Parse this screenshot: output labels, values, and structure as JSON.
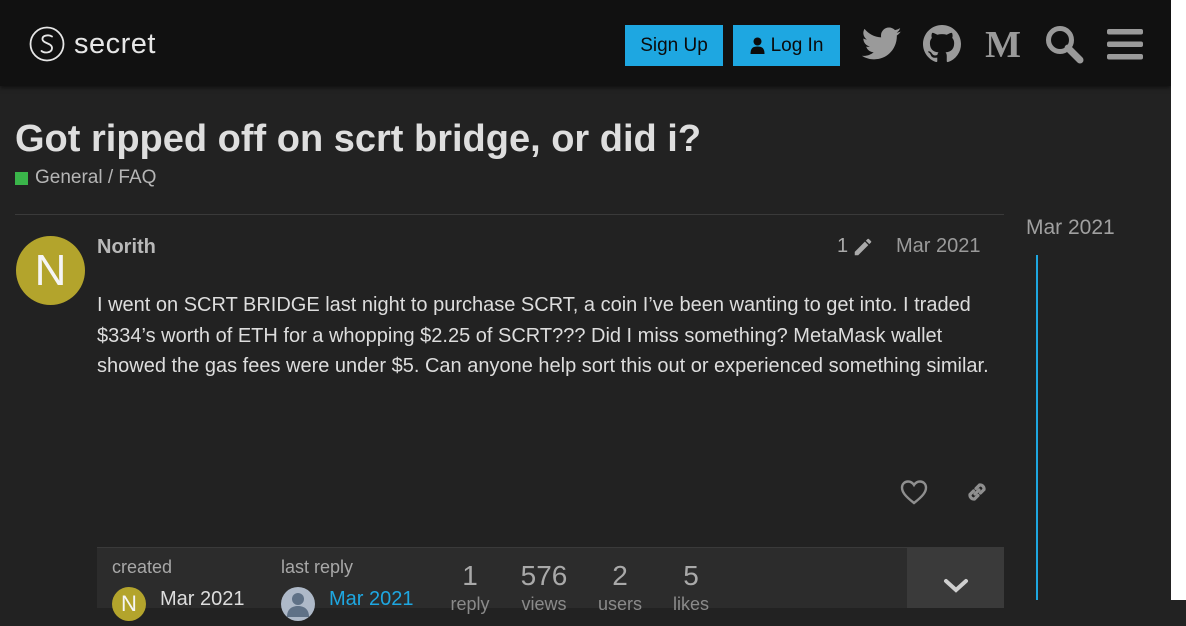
{
  "brand": {
    "name": "secret"
  },
  "header": {
    "signup_label": "Sign Up",
    "login_label": "Log In",
    "icons": [
      "twitter-icon",
      "github-icon",
      "medium-icon",
      "search-icon",
      "hamburger-menu-icon"
    ]
  },
  "topic": {
    "title": "Got ripped off on scrt bridge, or did i?",
    "category": "General / FAQ",
    "category_color": "#3ab54a"
  },
  "post": {
    "avatar_letter": "N",
    "avatar_color": "#b3a42c",
    "username": "Norith",
    "edit_count": "1",
    "date": "Mar 2021",
    "body": "I went on SCRT BRIDGE last night to purchase SCRT, a coin I’ve been wanting to get into. I traded $334’s worth of ETH for a whopping $2.25 of SCRT??? Did I miss something? MetaMask wallet showed the gas fees were under $5. Can anyone help sort this out or experienced something similar."
  },
  "topic_map": {
    "created_label": "created",
    "created_avatar_letter": "N",
    "created_date": "Mar 2021",
    "last_reply_label": "last reply",
    "last_reply_date": "Mar 2021",
    "stats": [
      {
        "value": "1",
        "label": "reply"
      },
      {
        "value": "576",
        "label": "views"
      },
      {
        "value": "2",
        "label": "users"
      },
      {
        "value": "5",
        "label": "likes"
      }
    ]
  },
  "timeline": {
    "date": "Mar 2021"
  },
  "colors": {
    "accent": "#1ea7e1",
    "background": "#222222",
    "header": "#111111"
  }
}
